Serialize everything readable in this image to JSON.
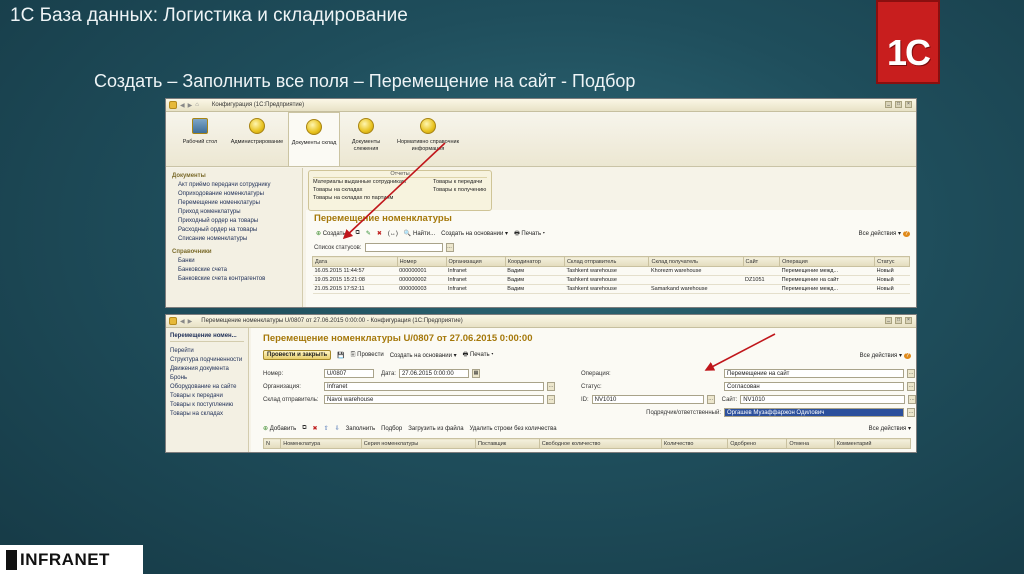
{
  "slide": {
    "title": "1С База данных: Логистика и складирование",
    "subtitle": "Создать – Заполнить все поля – Перемещение на сайт - Подбор",
    "logo_text": "1С",
    "company_logo": "INFRANET"
  },
  "win1": {
    "title": "Конфигурация (1С:Предприятие)",
    "sections": [
      {
        "label": "Рабочий стол",
        "icon": "desktop-icon"
      },
      {
        "label": "Администрирование",
        "icon": "section-icon"
      },
      {
        "label": "Документы склад",
        "icon": "section-icon"
      },
      {
        "label": "Документы слежения",
        "icon": "section-icon"
      },
      {
        "label": "Нормативно справочник информация",
        "icon": "section-icon"
      }
    ],
    "left_header_1": "Документы",
    "left_items_1": [
      "Акт приёмо передачи сотруднику",
      "Оприходование номенклатуры",
      "Перемещение номенклатуры",
      "Приход номенклатуры",
      "Приходный ордер на товары",
      "Расходный ордер на товары",
      "Списание номенклатуры"
    ],
    "left_header_2": "Справочники",
    "left_items_2": [
      "Банки",
      "Банковские счета",
      "Банковские счета контрагентов"
    ],
    "report_header": "Отчеты",
    "reports_left": [
      "Материалы выданные сотрудникам",
      "Товары на складах",
      "Товары на складах по партиям"
    ],
    "reports_right": [
      "Товары к передачи",
      "Товары к получению"
    ],
    "list_title": "Перемещение номенклатуры",
    "toolbar": {
      "create": "Создать",
      "find": "Найти...",
      "based_on": "Создать на основании",
      "print": "Печать",
      "all_actions": "Все действия"
    },
    "status_label": "Список статусов:",
    "columns": [
      "Дата",
      "Номер",
      "Организация",
      "Координатор",
      "Склад отправитель",
      "Склад получатель",
      "Сайт",
      "Операция",
      "Статус"
    ],
    "rows": [
      [
        "16.05.2015 11:44:57",
        "000000001",
        "Infranet",
        "Вадим",
        "Tashkent warehouse",
        "Khorezm warehouse",
        "",
        "Перемещение межд...",
        "Новый"
      ],
      [
        "19.05.2015 15:21:08",
        "000000002",
        "Infranet",
        "Вадим",
        "Tashkent warehouse",
        "",
        "DZ1051",
        "Перемещение на сайт",
        "Новый"
      ],
      [
        "21.05.2015 17:52:11",
        "000000003",
        "Infranet",
        "Вадим",
        "Tashkent warehouse",
        "Samarkand warehouse",
        "",
        "Перемещение межд...",
        "Новый"
      ]
    ]
  },
  "win2": {
    "title": "Перемещение номенклатуры U/0807 от 27.06.2015 0:00:00 - Конфигурация (1С:Предприятие)",
    "left_title": "Перемещение номен...",
    "left_items": [
      "Перейти",
      "Структура подчиненности",
      "Движения документа",
      "Бронь",
      "Оборудование на сайте",
      "Товары к передачи",
      "Товары к поступлению",
      "Товары на складах"
    ],
    "doc_title": "Перемещение номенклатуры U/0807 от 27.06.2015 0:00:00",
    "toolbar": {
      "post_close": "Провести и закрыть",
      "post": "Провести",
      "based_on": "Создать на основании",
      "print": "Печать",
      "all_actions": "Все действия"
    },
    "fields": {
      "number_label": "Номер:",
      "number": "U/0807",
      "date_label": "Дата:",
      "date": "27.06.2015 0:00:00",
      "org_label": "Организация:",
      "org": "Infranet",
      "sender_label": "Склад отправитель:",
      "sender": "Navoi warehouse",
      "operation_label": "Операция:",
      "operation": "Перемещение на сайт",
      "status_label": "Статус:",
      "status": "Согласован",
      "id_label": "ID:",
      "id": "NV1010",
      "site_label": "Сайт:",
      "site": "NV1010",
      "responsible_label": "Подрядчик/ответственный:",
      "responsible": "Оргашев Музаффаржон Одилович"
    },
    "table_toolbar": {
      "add": "Добавить",
      "fill": "Заполнить",
      "pick": "Подбор",
      "load": "Загрузить из файла",
      "delete_zero": "Удалить строки без количества",
      "all_actions": "Все действия"
    },
    "columns": [
      "N",
      "Номенклатура",
      "Серия номенклатуры",
      "Поставщик",
      "Свободное количество",
      "Количество",
      "Одобрено",
      "Отмена",
      "Комментарий"
    ]
  },
  "colors": {
    "accent_title": "#a5780a",
    "arrow": "#c0161b"
  }
}
